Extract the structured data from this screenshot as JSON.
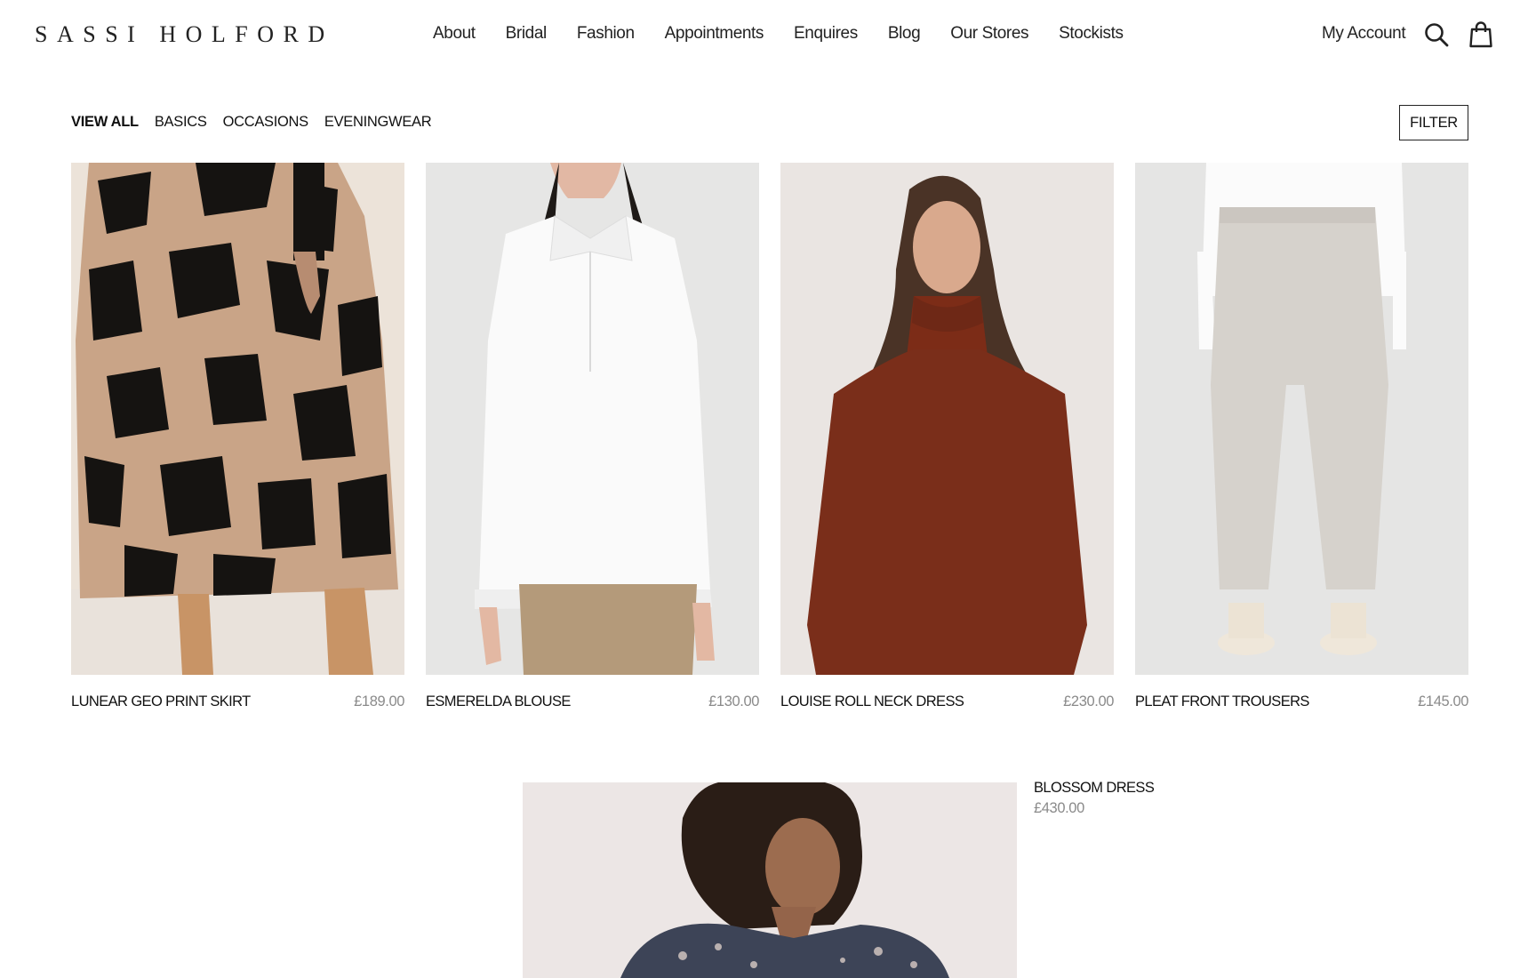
{
  "brand": {
    "logo_text": "SASSI HOLFORD"
  },
  "nav": {
    "items": [
      {
        "label": "About"
      },
      {
        "label": "Bridal"
      },
      {
        "label": "Fashion"
      },
      {
        "label": "Appointments"
      },
      {
        "label": "Enquires"
      },
      {
        "label": "Blog"
      },
      {
        "label": "Our Stores"
      },
      {
        "label": "Stockists"
      }
    ],
    "account_label": "My Account",
    "search_icon": "search-icon",
    "bag_icon": "shopping-bag-icon"
  },
  "categories": {
    "items": [
      {
        "label": "VIEW ALL",
        "active": true
      },
      {
        "label": "BASICS",
        "active": false
      },
      {
        "label": "OCCASIONS",
        "active": false
      },
      {
        "label": "EVENINGWEAR",
        "active": false
      }
    ],
    "filter_label": "FILTER"
  },
  "products": [
    {
      "name": "LUNEAR GEO PRINT SKIRT",
      "price": "£189.00"
    },
    {
      "name": "ESMERELDA BLOUSE",
      "price": "£130.00"
    },
    {
      "name": "LOUISE ROLL NECK DRESS",
      "price": "£230.00"
    },
    {
      "name": "PLEAT FRONT TROUSERS",
      "price": "£145.00"
    }
  ],
  "feature": {
    "name": "BLOSSOM DRESS",
    "price": "£430.00"
  },
  "colors": {
    "text": "#111111",
    "price": "#8a8a8a",
    "background": "#ffffff"
  }
}
